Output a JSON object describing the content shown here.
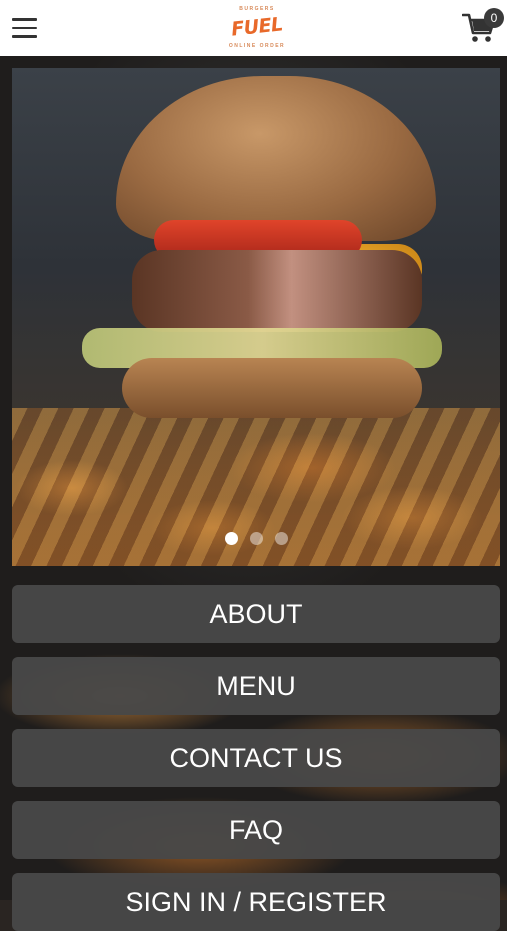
{
  "header": {
    "menu_icon": "hamburger-icon",
    "logo": {
      "word": "FUEL",
      "top_text": "BURGERS",
      "bottom_text": "ONLINE ORDER"
    },
    "cart": {
      "icon": "cart-icon",
      "count": "0"
    }
  },
  "hero": {
    "image": "burger-and-fries-photo",
    "slides_total": 3,
    "active_slide": 1
  },
  "nav": {
    "buttons": [
      {
        "label": "ABOUT"
      },
      {
        "label": "MENU"
      },
      {
        "label": "CONTACT US"
      },
      {
        "label": "FAQ"
      },
      {
        "label": "SIGN IN / REGISTER"
      }
    ]
  },
  "colors": {
    "header_bg": "#ffffff",
    "logo_orange": "#e8692a",
    "button_bg": "#484848",
    "button_text": "#ffffff"
  }
}
